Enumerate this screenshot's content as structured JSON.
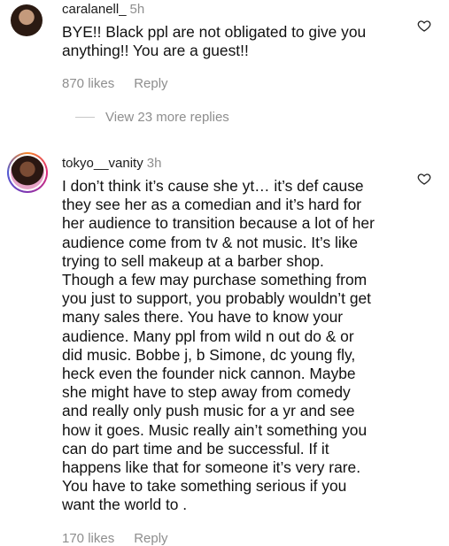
{
  "comments": [
    {
      "username": "caralanell_",
      "time": "5h",
      "text": "BYE!! Black ppl are not obligated to give you\nanything!! You are a guest!!",
      "likes": "870 likes",
      "reply": "Reply"
    },
    {
      "username": "tokyo__vanity",
      "time": "3h",
      "text": "I don’t think it’s cause she yt… it’s def cause\nthey see her as a comedian and it’s hard for\nher audience to transition because a lot of her\naudience come from tv & not music. It’s like\ntrying to sell makeup at a barber shop.\nThough a few may purchase something from\nyou just to support, you probably wouldn’t get\nmany sales there. You have to know your\naudience. Many ppl from wild n out do & or\ndid music. Bobbe j, b Simone, dc young fly,\nheck even the founder nick cannon. Maybe\nshe might have to step away from comedy\nand really only push music for a yr and see\nhow it goes. Music really ain’t something you\ncan do part time and be successful. If it\nhappens like that for someone it’s very rare.\nYou have to take something serious if you\nwant the world to .",
      "likes": "170 likes",
      "reply": "Reply"
    }
  ],
  "view_replies": "View 23 more replies",
  "icons": {
    "heart": "heart-outline-icon"
  },
  "colors": {
    "meta_gray": "#8e8e8e",
    "text": "#111111"
  }
}
